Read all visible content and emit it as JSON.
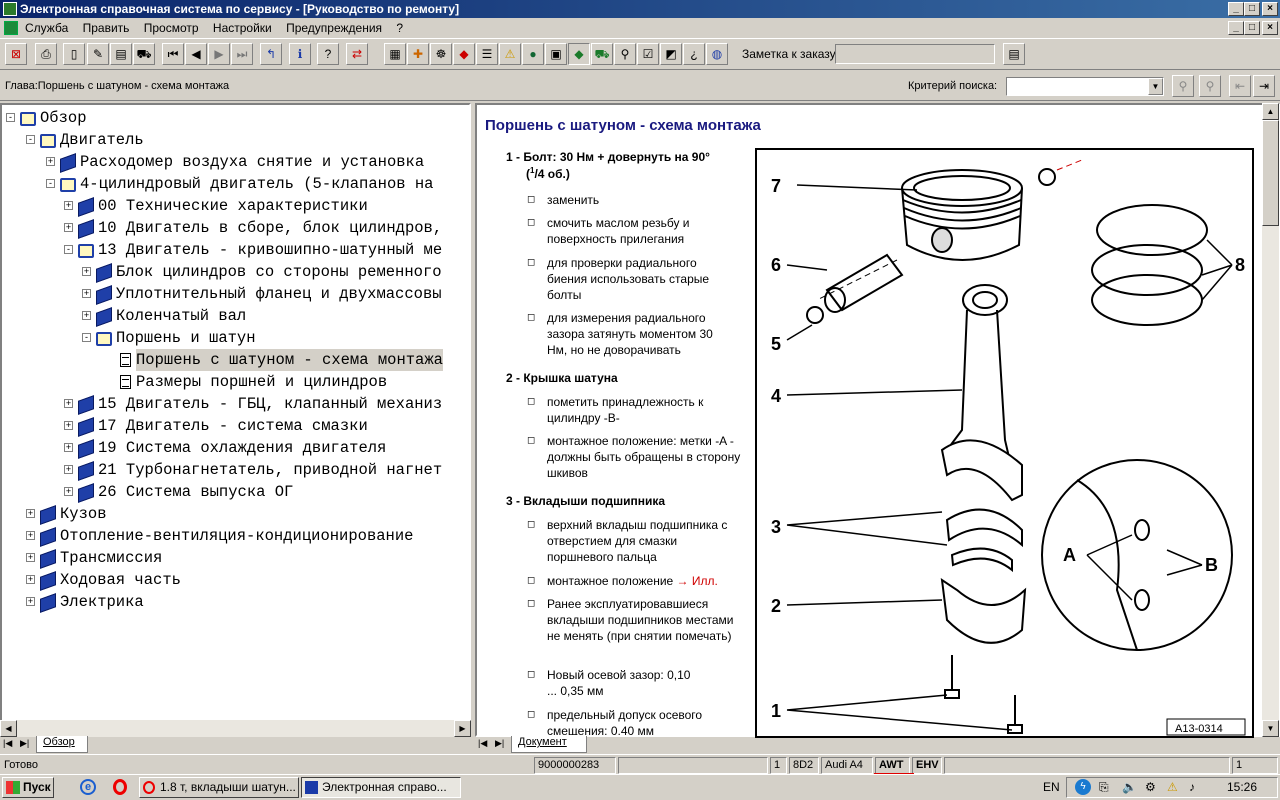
{
  "window": {
    "title": "Электронная справочная система по сервису - [Руководство по ремонту]"
  },
  "menu": {
    "items": [
      "Служба",
      "Править",
      "Просмотр",
      "Настройки",
      "Предупреждения",
      "?"
    ]
  },
  "toolbar": {
    "note_label": "Заметка к заказу:",
    "note_value": ""
  },
  "chapter": {
    "text": "Глава:Поршень с шатуном - схема монтажа",
    "search_label": "Критерий поиска:",
    "search_value": ""
  },
  "tree": {
    "items": [
      {
        "label": "Обзор"
      },
      {
        "label": "Двигатель"
      },
      {
        "label": "Расходомер воздуха снятие и установка"
      },
      {
        "label": "4-цилиндровый двигатель (5-клапанов на"
      },
      {
        "label": "00 Технические характеристики"
      },
      {
        "label": "10 Двигатель в сборе, блок цилиндров,"
      },
      {
        "label": "13 Двигатель - кривошипно-шатунный ме"
      },
      {
        "label": "Блок цилиндров со стороны ременного"
      },
      {
        "label": "Уплотнительный фланец и двухмассовы"
      },
      {
        "label": "Коленчатый вал"
      },
      {
        "label": "Поршень и шатун"
      },
      {
        "label": "Поршень с шатуном - схема монтажа"
      },
      {
        "label": "Размеры поршней и цилиндров"
      },
      {
        "label": "15 Двигатель - ГБЦ, клапанный механиз"
      },
      {
        "label": "17 Двигатель - система смазки"
      },
      {
        "label": "19 Система охлаждения двигателя"
      },
      {
        "label": "21 Турбонагнетатель, приводной нагнет"
      },
      {
        "label": "26 Система выпуска ОГ"
      },
      {
        "label": "Кузов"
      },
      {
        "label": "Отопление-вентиляция-кондиционирование"
      },
      {
        "label": "Трансмиссия"
      },
      {
        "label": "Ходовая часть"
      },
      {
        "label": "Электрика"
      }
    ],
    "tab": "Обзор"
  },
  "doc": {
    "title": "Поршень с шатуном - схема монтажа",
    "tab": "Документ",
    "item1_title": "1 - Болт: 30 Нм + довернуть на 90°",
    "item1_title_b": "(",
    "item1_frac_num": "1",
    "item1_frac_den": "/4 об.)",
    "item1_b1": "заменить",
    "item1_b2": "смочить маслом резьбу и поверхность прилегания",
    "item1_b3": "для проверки радиального биения использовать старые болты",
    "item1_b4": "для измерения радиального зазора затянуть моментом 30 Нм, но не доворачивать",
    "item2_title": "2 - Крышка шатуна",
    "item2_b1": "пометить принадлежность к цилиндру -B-",
    "item2_b2": "монтажное положение: метки -A - должны быть обращены в сторону шкивов",
    "item3_title": "3 - Вкладыши подшипника",
    "item3_b1": "верхний вкладыш подшипника с отверстием для смазки поршневого пальца",
    "item3_b2": "монтажное положение ",
    "item3_b2_link": "→ Илл.",
    "item3_b3": "Ранее эксплуатировавшиеся вкладыши подшипников местами не менять (при снятии помечать)",
    "item3_b4": "Новый осевой зазор: 0,10 ... 0,35 мм",
    "item3_b5": "предельный допуск осевого смещения: 0,40 мм",
    "bullet": "◻"
  },
  "illustration": {
    "labels": [
      "7",
      "6",
      "5",
      "4",
      "3",
      "2",
      "1",
      "8",
      "A",
      "B"
    ],
    "code": "A13-0314"
  },
  "status": {
    "text": "Готово",
    "order": "9000000283",
    "f1": "1",
    "f2": "8D2",
    "model": "Audi A4",
    "engine": "AWT",
    "trans": "EHV",
    "f3": "1"
  },
  "taskbar": {
    "start": "Пуск",
    "tasks": [
      "1.8 т, вкладыши шатун...",
      "Электронная справо..."
    ],
    "lang": "EN",
    "time": "15:26"
  }
}
